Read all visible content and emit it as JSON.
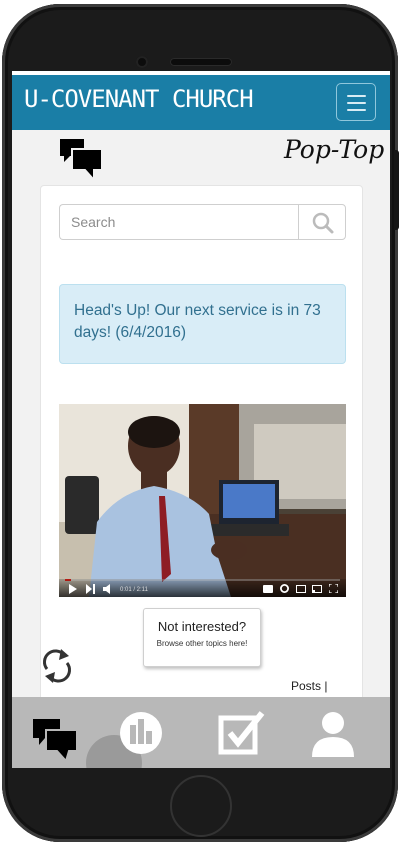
{
  "header": {
    "brand": "U-COVENANT CHURCH",
    "menu_icon": "hamburger-icon"
  },
  "page": {
    "title": "Pop-Top",
    "title_icon": "chat-bubbles-icon"
  },
  "search": {
    "placeholder": "Search",
    "icon": "search-icon"
  },
  "alert": {
    "text": "Head's Up! Our next service is in 73 days! (6/4/2016)"
  },
  "video": {
    "time": "0:01 / 2:11",
    "progress": 0.01,
    "accent": "#e62117"
  },
  "tooltip": {
    "title": "Not interested?",
    "subtitle": "Browse other topics here!"
  },
  "refresh_icon": "refresh-icon",
  "posts": {
    "label": "Posts |"
  },
  "bottom_nav": [
    {
      "icon": "chat-bubbles-icon",
      "active": true
    },
    {
      "icon": "bar-chart-icon",
      "active": false
    },
    {
      "icon": "checkbox-icon",
      "active": false
    },
    {
      "icon": "user-icon",
      "active": false
    }
  ],
  "colors": {
    "brand": "#1a7ea6",
    "alert_bg": "#d9edf7",
    "alert_text": "#31708f",
    "nav_bg": "#b8b8b8"
  }
}
